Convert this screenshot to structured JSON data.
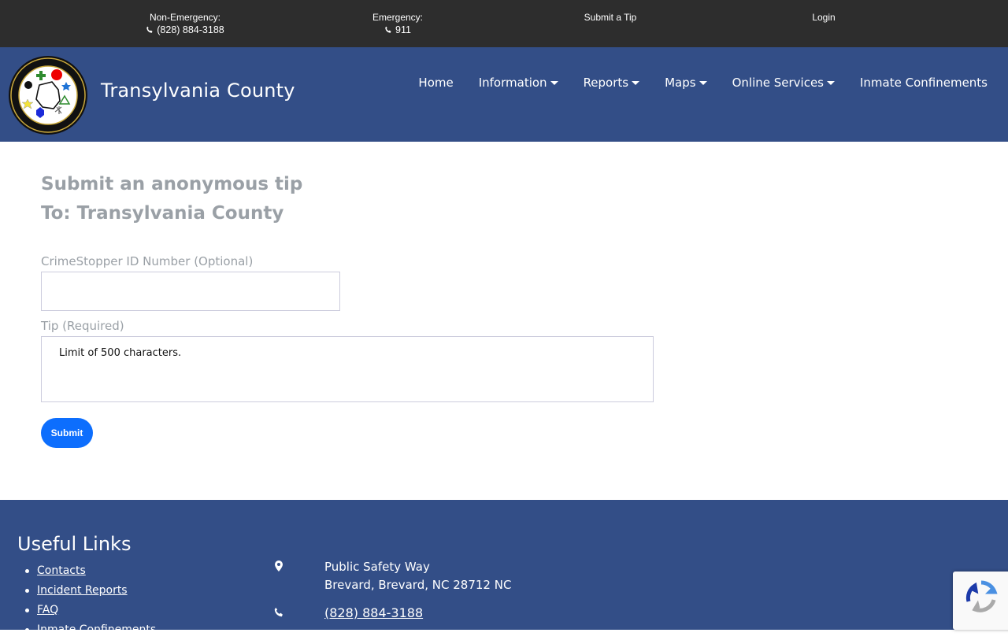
{
  "topbar": {
    "non_emergency_label": "Non-Emergency:",
    "non_emergency_phone": "(828) 884-3188",
    "emergency_label": "Emergency:",
    "emergency_phone": "911",
    "submit_tip": "Submit a Tip",
    "login": "Login"
  },
  "header": {
    "site_title": "Transylvania County",
    "nav": [
      {
        "label": "Home"
      },
      {
        "label": "Information"
      },
      {
        "label": "Reports"
      },
      {
        "label": "Maps"
      },
      {
        "label": "Online Services"
      },
      {
        "label": "Inmate Confinements"
      }
    ]
  },
  "form": {
    "heading_line1": "Submit an anonymous tip",
    "heading_line2": "To: Transylvania County",
    "id_label": "CrimeStopper ID Number (Optional)",
    "id_value": "",
    "tip_label": "Tip (Required)",
    "tip_placeholder": "Limit of 500 characters.",
    "submit_label": "Submit"
  },
  "footer": {
    "useful_links_title": "Useful Links",
    "links": [
      "Contacts",
      "Incident Reports",
      "FAQ",
      "Inmate Confinements"
    ],
    "address_line1": "Public Safety Way",
    "address_line2": "Brevard, Brevard, NC 28712 NC",
    "phone": "(828) 884-3188"
  },
  "colors": {
    "topbar_bg": "#2d2d2d",
    "brand_blue": "#334e87",
    "button_blue": "#0d6efd",
    "heading_gray": "#9aa0a6"
  },
  "icons": [
    "phone-icon",
    "chevron-down-icon",
    "location-pin-icon",
    "recaptcha-icon",
    "county-seal-logo"
  ]
}
